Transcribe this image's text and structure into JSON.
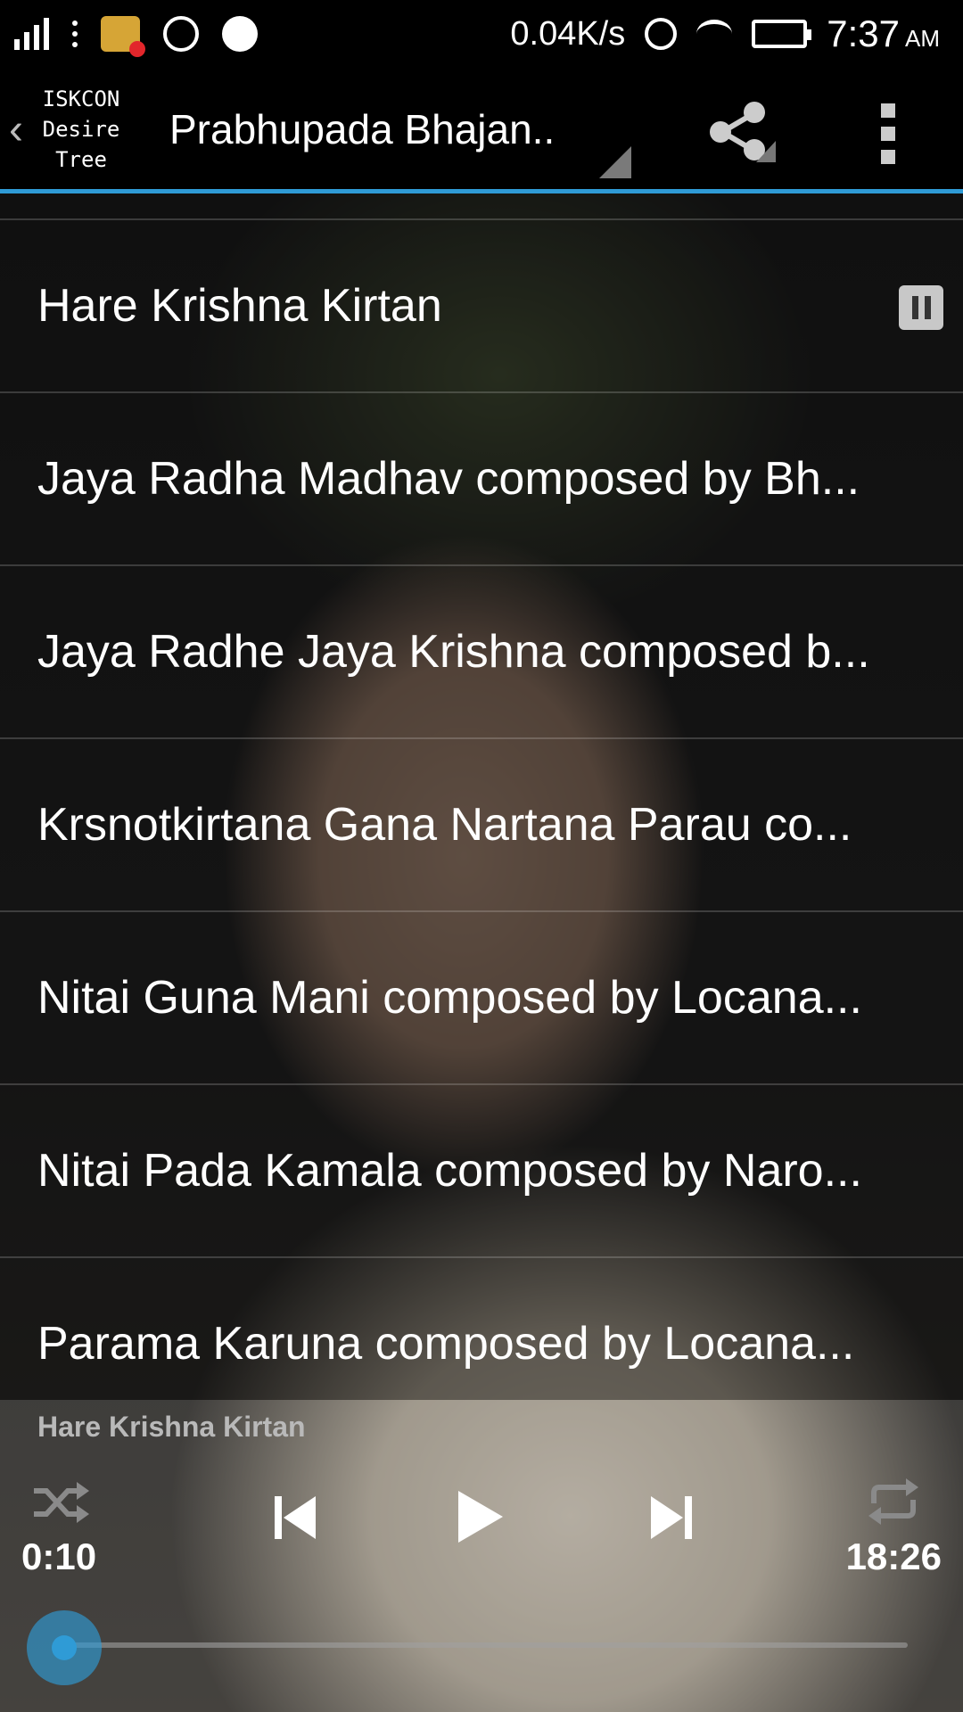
{
  "status_bar": {
    "net_speed": "0.04K/s",
    "time": "7:37",
    "ampm": "AM"
  },
  "action_bar": {
    "logo_lines": [
      "ISKCON",
      "Desire",
      "Tree"
    ],
    "title": "Prabhupada Bhajan..",
    "accent": "#2f9bd6"
  },
  "tracks": [
    {
      "title": "Hare Krishna Kirtan",
      "playing": true
    },
    {
      "title": "Jaya Radha Madhav composed by Bh..."
    },
    {
      "title": "Jaya Radhe Jaya Krishna composed b..."
    },
    {
      "title": "Krsnotkirtana Gana Nartana Parau co..."
    },
    {
      "title": "Nitai Guna Mani composed by Locana..."
    },
    {
      "title": "Nitai Pada Kamala composed by Naro..."
    },
    {
      "title": "Parama Karuna composed by Locana..."
    }
  ],
  "player": {
    "now_playing": "Hare Krishna Kirtan",
    "current_time": "0:10",
    "total_time": "18:26",
    "progress_fraction": 0.009
  }
}
